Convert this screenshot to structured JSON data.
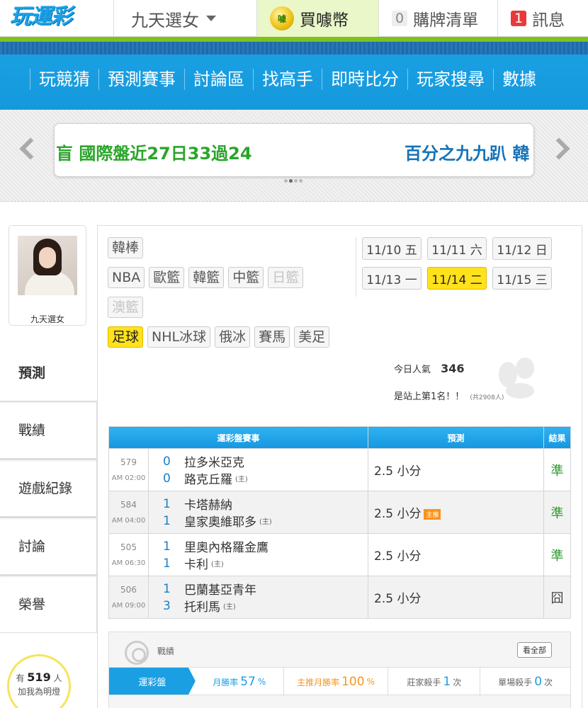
{
  "header": {
    "logo_text": "玩運彩",
    "user_menu_label": "九天選女",
    "coins_icon_text": "噱",
    "coins_label": "買噱幣",
    "cart_count": "0",
    "cart_label": "購牌清單",
    "message_count": "1",
    "message_label": "訊息"
  },
  "nav": {
    "items": [
      "玩競猜",
      "預測賽事",
      "討論區",
      "找高手",
      "即時比分",
      "玩家搜尋",
      "數據"
    ]
  },
  "marquee": {
    "text_a": "盲 國際盤近27日33過24",
    "text_b": "百分之九九趴 韓"
  },
  "profile": {
    "name": "九天選女",
    "fans_prefix": "有",
    "fans_count": "519",
    "fans_suffix": "人",
    "fans_cta": "加我為明燈"
  },
  "sidemenu": {
    "items": [
      "預測",
      "戰績",
      "遊戲紀錄",
      "討論",
      "榮譽"
    ]
  },
  "sports": {
    "row1": [
      "韓棒"
    ],
    "row2": [
      "NBA",
      "歐籃",
      "韓籃",
      "中籃",
      "日籃"
    ],
    "row3": [
      "澳籃"
    ],
    "row4": [
      "足球",
      "NHL冰球",
      "俄冰",
      "賽馬",
      "美足"
    ],
    "selected": "足球",
    "disabled": [
      "日籃",
      "澳籃"
    ]
  },
  "dates": {
    "items": [
      "11/10 五",
      "11/11 六",
      "11/12 日",
      "11/13 一",
      "11/14 二",
      "11/15 三"
    ],
    "selected": "11/14 二"
  },
  "stats": {
    "popularity_label": "今日人氣",
    "popularity_value": "346",
    "rank_text": "是站上第1名！！",
    "rank_total": "(共2908人)"
  },
  "table": {
    "headers": [
      "運彩盤賽事",
      "預測",
      "結果"
    ],
    "home_mark": "(主)",
    "rows": [
      {
        "id": "579",
        "time": "AM 02:00",
        "score_away": "0",
        "team_away": "拉多米亞克",
        "score_home": "0",
        "team_home": "路克丘羅",
        "prediction": "2.5 小分",
        "badge": "",
        "result": "準"
      },
      {
        "id": "584",
        "time": "AM 04:00",
        "score_away": "1",
        "team_away": "卡塔赫納",
        "score_home": "1",
        "team_home": "皇家奧維耶多",
        "prediction": "2.5 小分",
        "badge": "主推",
        "result": "準"
      },
      {
        "id": "505",
        "time": "AM 06:30",
        "score_away": "1",
        "team_away": "里奧內格羅金鷹",
        "score_home": "1",
        "team_home": "卡利",
        "prediction": "2.5 小分",
        "badge": "",
        "result": "準"
      },
      {
        "id": "506",
        "time": "AM 09:00",
        "score_away": "1",
        "team_away": "巴蘭基亞青年",
        "score_home": "3",
        "team_home": "托利馬",
        "prediction": "2.5 小分",
        "badge": "",
        "result": "囧"
      }
    ]
  },
  "record": {
    "title": "戰績",
    "view_all": "看全部",
    "tab": "運彩盤",
    "month_rate_label": "月勝率",
    "month_rate_value": "57",
    "month_rate_unit": "%",
    "main_rate_label": "主推月勝率",
    "main_rate_value": "100",
    "main_rate_unit": "%",
    "banker_label": "莊家殺手",
    "banker_value": "1",
    "banker_unit": "次",
    "single_label": "單場殺手",
    "single_value": "0",
    "single_unit": "次"
  },
  "colors": {
    "brand_blue": "#1a9fe3",
    "accent_green": "#7dc21e",
    "highlight_yellow": "#ffe21c",
    "orange": "#f7941d",
    "win_green": "#2a9a2a"
  }
}
